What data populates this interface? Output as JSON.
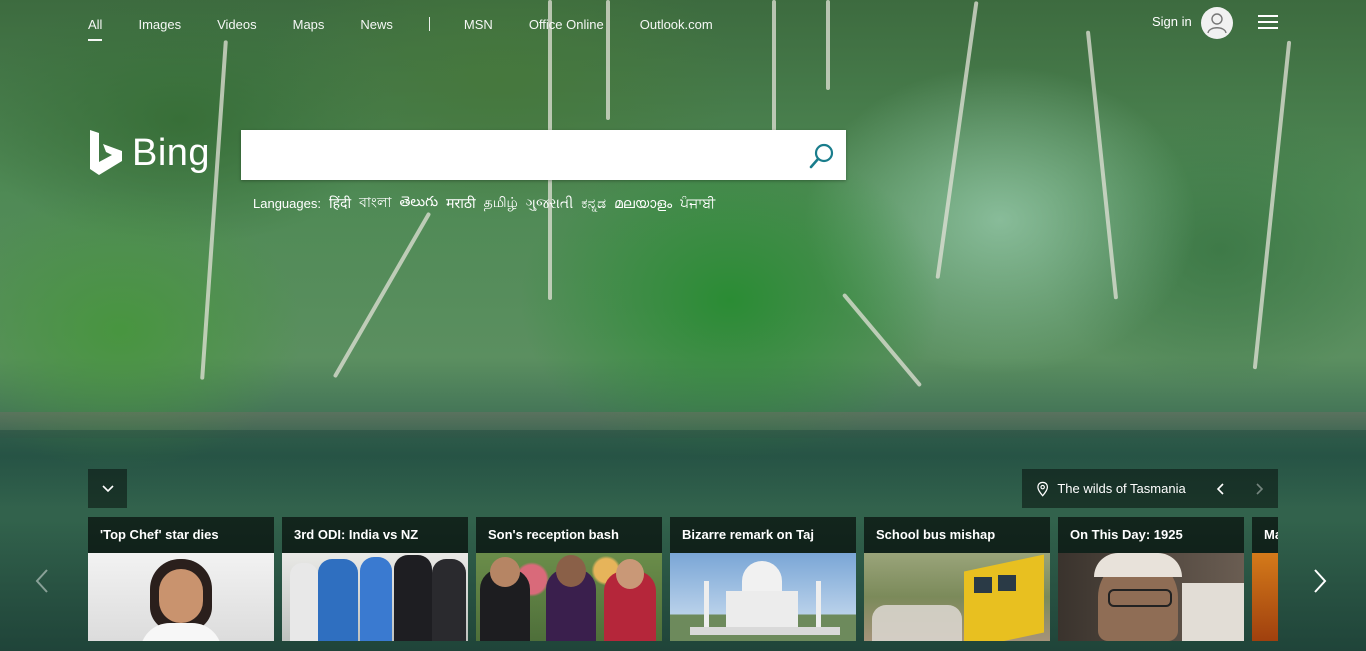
{
  "nav": {
    "all": "All",
    "images": "Images",
    "videos": "Videos",
    "maps": "Maps",
    "news": "News",
    "msn": "MSN",
    "office": "Office Online",
    "outlook": "Outlook.com"
  },
  "header": {
    "signin": "Sign in"
  },
  "logo": {
    "text": "Bing"
  },
  "search": {
    "value": "",
    "placeholder": ""
  },
  "languages": {
    "label": "Languages:",
    "items": [
      "हिंदी",
      "বাংলা",
      "తెలుగు",
      "मराठी",
      "தமிழ்",
      "ગુજરાતી",
      "ಕನ್ನಡ",
      "മലയാളം",
      "ਪੰਜਾਬੀ"
    ]
  },
  "location": {
    "caption": "The wilds of Tasmania"
  },
  "news": [
    {
      "title": "'Top Chef' star dies"
    },
    {
      "title": "3rd ODI: India vs NZ"
    },
    {
      "title": "Son's reception bash"
    },
    {
      "title": "Bizarre remark on Taj"
    },
    {
      "title": "School bus mishap"
    },
    {
      "title": "On This Day: 1925"
    },
    {
      "title": "Ma"
    }
  ],
  "colors": {
    "search_icon": "#1a7d8c",
    "overlay": "rgba(0,0,0,0.45)"
  }
}
